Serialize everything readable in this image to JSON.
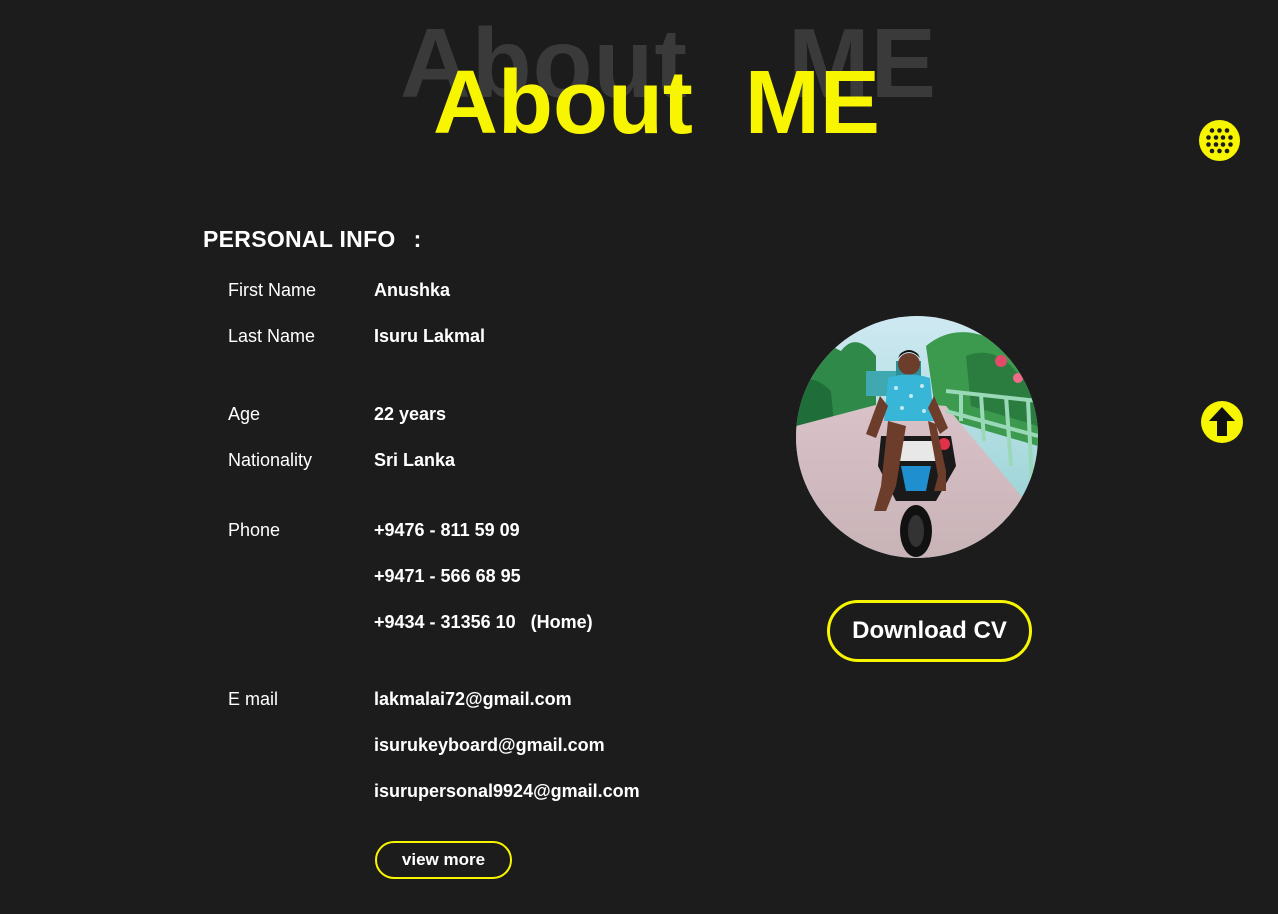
{
  "header": {
    "title_word1": "About",
    "title_word2": "ME"
  },
  "colors": {
    "accent": "#f8f500",
    "background": "#1c1c1c",
    "shadow_text": "#3a3a3a",
    "text": "#ffffff"
  },
  "nav": {
    "menu_icon": "grid-dots-icon",
    "scroll_top_icon": "arrow-up-icon"
  },
  "personal_info": {
    "heading": "PERSONAL INFO",
    "colon": ":",
    "first_name": {
      "label": "First Name",
      "value": "Anushka"
    },
    "last_name": {
      "label": "Last Name",
      "value": "Isuru Lakmal"
    },
    "age": {
      "label": "Age",
      "value": "22 years"
    },
    "nationality": {
      "label": "Nationality",
      "value": "Sri Lanka"
    },
    "phone": {
      "label": "Phone",
      "values": [
        "+9476 - 811 59 09",
        "+9471 - 566 68 95",
        "+9434 - 31356 10   (Home)"
      ]
    },
    "email": {
      "label": "E mail",
      "values": [
        "lakmalai72@gmail.com",
        "isurukeyboard@gmail.com",
        "isurupersonal9924@gmail.com"
      ]
    },
    "view_more_label": "view more"
  },
  "profile": {
    "photo_icon": "profile-photo",
    "download_cv_label": "Download CV"
  }
}
